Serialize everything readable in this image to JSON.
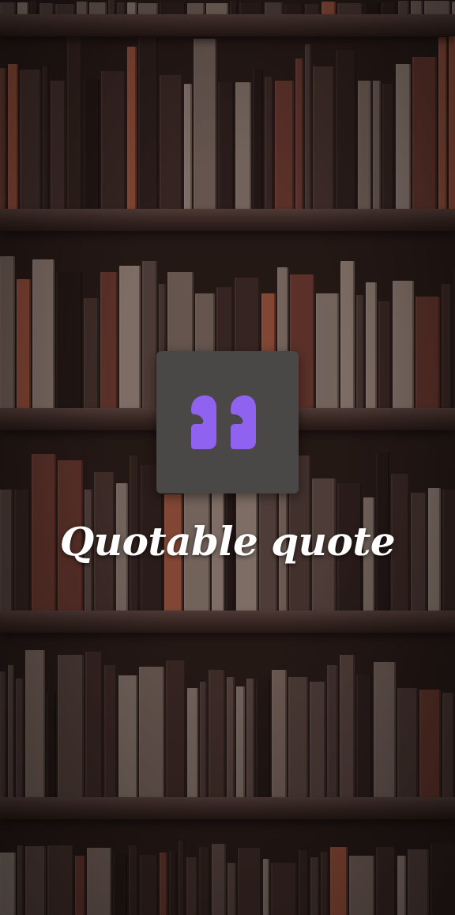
{
  "app": {
    "title": "Quotable quote"
  },
  "logo": {
    "icon": "quote-marks-icon",
    "accent_color": "#8f62f0",
    "tile_color": "#4a4747"
  },
  "background": {
    "description_icon": "bookshelf-background"
  }
}
